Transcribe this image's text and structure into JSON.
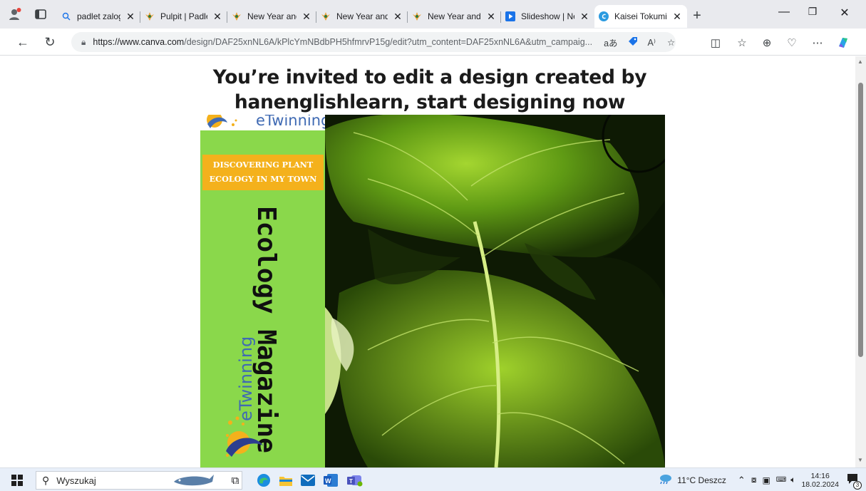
{
  "browser": {
    "tabs": [
      {
        "title": "padlet zaloguj - ",
        "icon": "search-favicon"
      },
      {
        "title": "Pulpit | Padlet",
        "icon": "padlet-favicon"
      },
      {
        "title": "New Year and Ch",
        "icon": "padlet-favicon"
      },
      {
        "title": "New Year and Ch",
        "icon": "padlet-favicon"
      },
      {
        "title": "New Year and Ch",
        "icon": "padlet-favicon"
      },
      {
        "title": "Slideshow | New",
        "icon": "slideshow-favicon"
      },
      {
        "title": "Kaisei Tokumin",
        "icon": "canva-favicon",
        "active": true
      }
    ],
    "url_host": "https://www.canva.com",
    "url_path": "/design/DAF25xnNL6A/kPlcYmNBdbPH5hfmrvP15g/edit?utm_content=DAF25xnNL6A&utm_campaig...",
    "read_aloud_badge": "aあ"
  },
  "page": {
    "headline_line1": "You’re invited to edit a design created by",
    "headline_line2": "hanenglishlearn, start designing now",
    "design": {
      "etwinning_top": "eTwinning",
      "title_line1": "DISCOVERING PLANT",
      "title_line2": "ECOLOGY IN MY TOWN",
      "magazine_title": "Ecology Magazine",
      "etwinning_side": "eTwinning"
    }
  },
  "taskbar": {
    "search_placeholder": "Wyszukaj",
    "weather": "11°C  Deszcz",
    "time": "14:16",
    "date": "18.02.2024",
    "notification_count": "3"
  },
  "colors": {
    "panel_green": "#8ad84b",
    "title_box_orange": "#f4b11c",
    "etwinning_blue": "#3f6ab3",
    "tabbar_bg": "#e9eaee",
    "taskbar_bg": "#e8eff9"
  }
}
